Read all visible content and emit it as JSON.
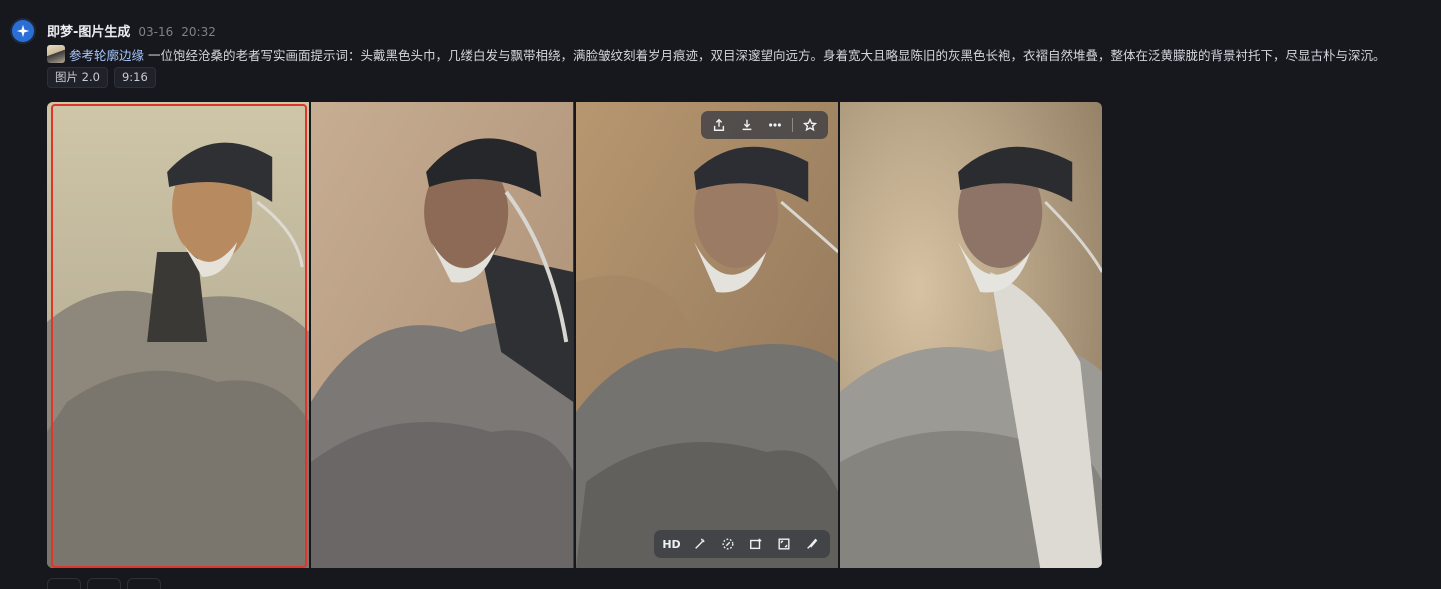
{
  "message": {
    "sender": "即梦-图片生成",
    "date": "03-16",
    "time": "20:32",
    "reference_label": "参考轮廓边缘",
    "prompt": "一位饱经沧桑的老者写实画面提示词：头戴黑色头巾，几缕白发与飘带相绕，满脸皱纹刻着岁月痕迹，双目深邃望向远方。身着宽大且略显陈旧的灰黑色长袍，衣褶自然堆叠，整体在泛黄朦胧的背景衬托下，尽显古朴与深沉。",
    "tags": [
      "图片 2.0",
      "9:16"
    ]
  },
  "images": [
    {
      "id": "image-1",
      "selected": true
    },
    {
      "id": "image-2",
      "selected": false
    },
    {
      "id": "image-3",
      "selected": false,
      "hover": true
    },
    {
      "id": "image-4",
      "selected": false
    }
  ],
  "hover_toolbar_top": [
    "share-icon",
    "download-icon",
    "more-icon",
    "star-icon"
  ],
  "hover_toolbar_bottom": {
    "hd_label": "HD",
    "icons": [
      "magic-wand-icon",
      "eraser-icon",
      "expand-image-icon",
      "crop-icon",
      "brush-icon"
    ]
  },
  "colors": {
    "background": "#16181e",
    "selection": "#e0352b",
    "link": "#a6c8ff"
  }
}
